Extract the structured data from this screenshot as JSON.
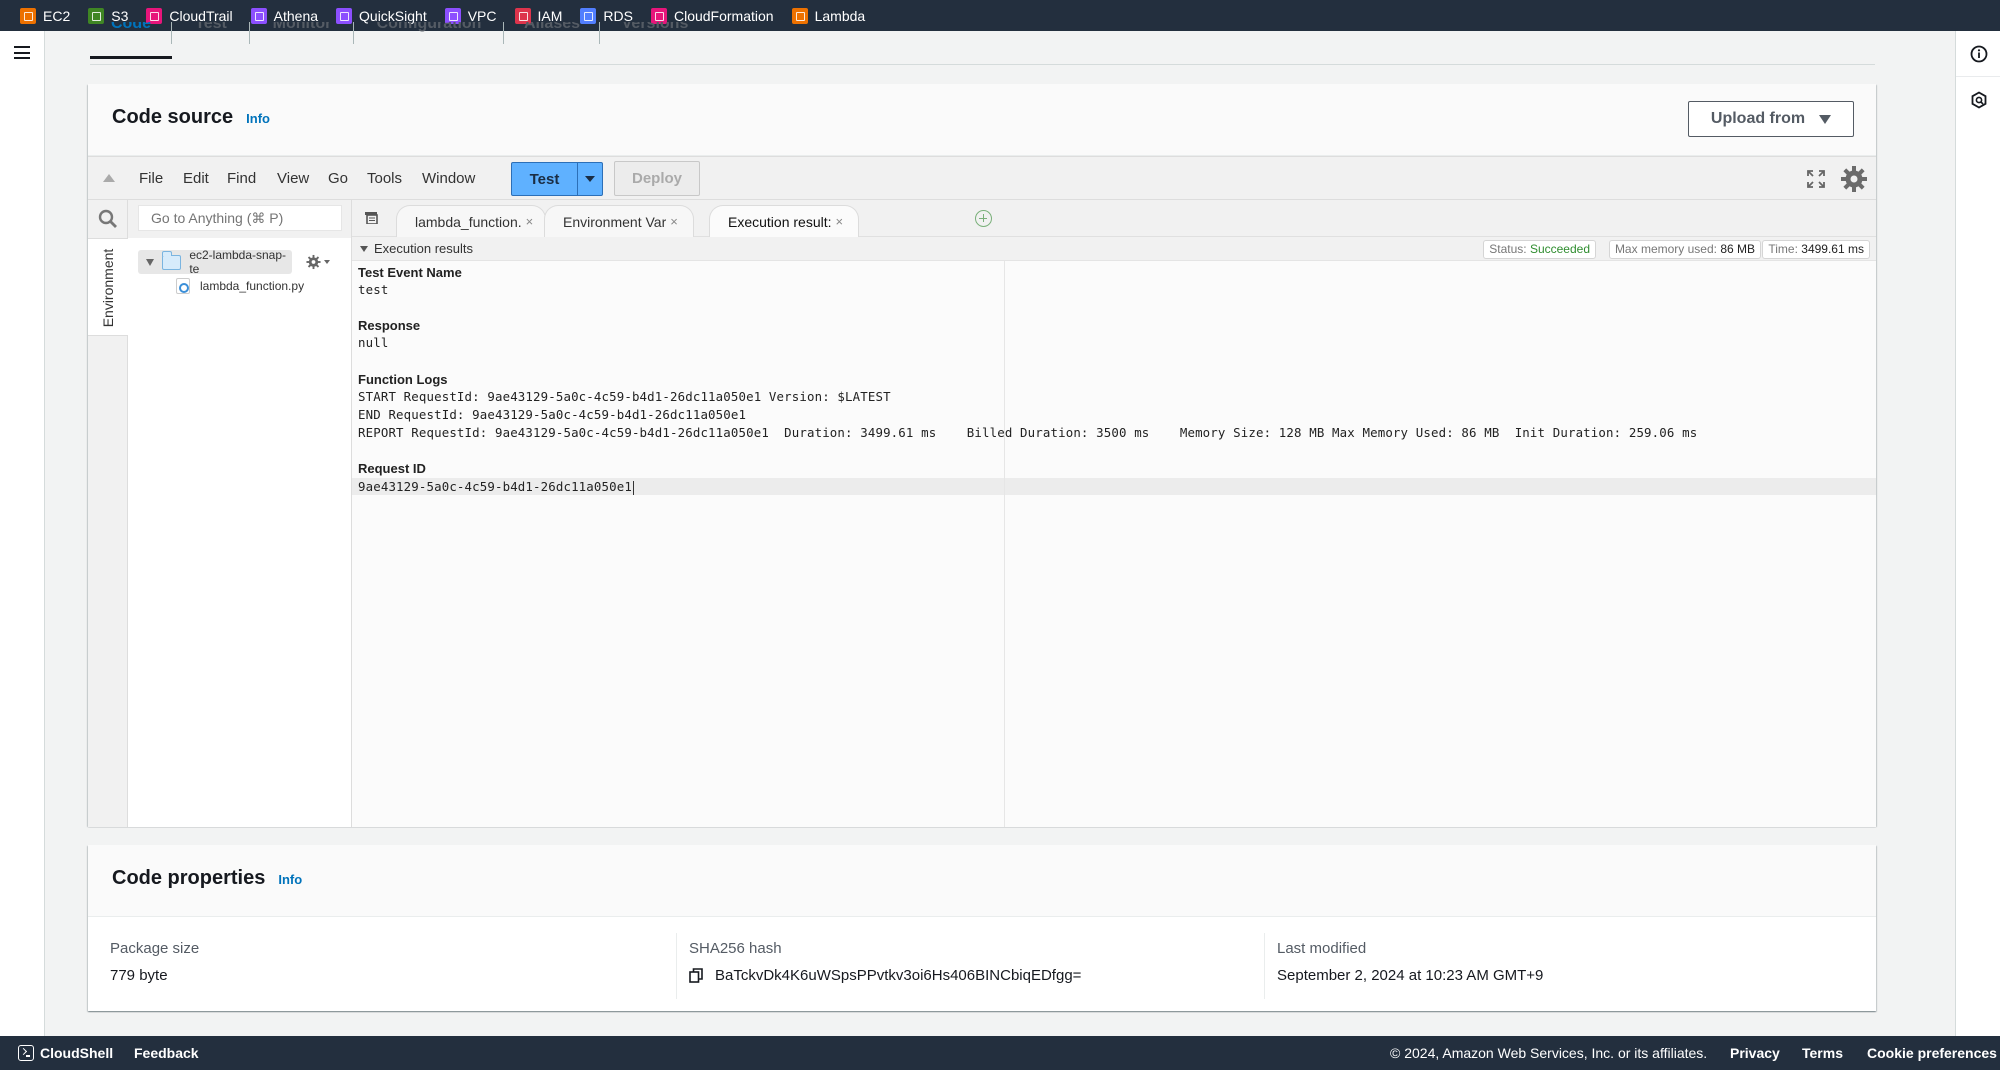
{
  "service_bar": [
    {
      "label": "EC2",
      "icon": "ec2-icon",
      "color": "#ed7100"
    },
    {
      "label": "S3",
      "icon": "s3-icon",
      "color": "#3f8624"
    },
    {
      "label": "CloudTrail",
      "icon": "cloudtrail-icon",
      "color": "#e7157b"
    },
    {
      "label": "Athena",
      "icon": "athena-icon",
      "color": "#8c4fff"
    },
    {
      "label": "QuickSight",
      "icon": "quicksight-icon",
      "color": "#8c4fff"
    },
    {
      "label": "VPC",
      "icon": "vpc-icon",
      "color": "#8c4fff"
    },
    {
      "label": "IAM",
      "icon": "iam-icon",
      "color": "#dd344c"
    },
    {
      "label": "RDS",
      "icon": "rds-icon",
      "color": "#527fff"
    },
    {
      "label": "CloudFormation",
      "icon": "cloudformation-icon",
      "color": "#e7157b"
    },
    {
      "label": "Lambda",
      "icon": "lambda-icon",
      "color": "#ed7100"
    }
  ],
  "page_tabs": [
    {
      "label": "Code",
      "active": true
    },
    {
      "label": "Test"
    },
    {
      "label": "Monitor"
    },
    {
      "label": "Configuration"
    },
    {
      "label": "Aliases"
    },
    {
      "label": "Versions"
    }
  ],
  "code_source": {
    "title": "Code source",
    "info": "Info",
    "upload_label": "Upload from"
  },
  "ide": {
    "menu": [
      "File",
      "Edit",
      "Find",
      "View",
      "Go",
      "Tools",
      "Window"
    ],
    "test_label": "Test",
    "deploy_label": "Deploy",
    "goto_placeholder": "Go to Anything (⌘ P)",
    "env_tab_label": "Environment",
    "tree": {
      "folder": "ec2-lambda-snap-te",
      "file": "lambda_function.py"
    },
    "tabs": [
      {
        "label": "lambda_function.",
        "close": "×"
      },
      {
        "label": "Environment Var",
        "close": "×"
      },
      {
        "label": "Execution result:",
        "close": "×",
        "active": true
      }
    ]
  },
  "execution_results": {
    "header": "Execution results",
    "status_label": "Status:",
    "status_value": "Succeeded",
    "status_color": "#2f8d2f",
    "memory_label": "Max memory used:",
    "memory_value": "86 MB",
    "time_label": "Time:",
    "time_value": "3499.61 ms",
    "test_event_name_label": "Test Event Name",
    "test_event_name": "test",
    "response_label": "Response",
    "response": "null",
    "function_logs_label": "Function Logs",
    "logs": [
      "START RequestId: 9ae43129-5a0c-4c59-b4d1-26dc11a050e1 Version: $LATEST",
      "END RequestId: 9ae43129-5a0c-4c59-b4d1-26dc11a050e1",
      "REPORT RequestId: 9ae43129-5a0c-4c59-b4d1-26dc11a050e1  Duration: 3499.61 ms    Billed Duration: 3500 ms    Memory Size: 128 MB Max Memory Used: 86 MB  Init Duration: 259.06 ms"
    ],
    "request_id_label": "Request ID",
    "request_id": "9ae43129-5a0c-4c59-b4d1-26dc11a050e1"
  },
  "code_properties": {
    "title": "Code properties",
    "info": "Info",
    "package_size_label": "Package size",
    "package_size": "779 byte",
    "sha_label": "SHA256 hash",
    "sha_value": "BaTckvDk4K6uWSpsPPvtkv3oi6Hs406BINCbiqEDfgg=",
    "last_modified_label": "Last modified",
    "last_modified": "September 2, 2024 at 10:23 AM GMT+9"
  },
  "footer": {
    "cloudshell": "CloudShell",
    "feedback": "Feedback",
    "copyright": "© 2024, Amazon Web Services, Inc. or its affiliates.",
    "privacy": "Privacy",
    "terms": "Terms",
    "cookies": "Cookie preferences"
  }
}
